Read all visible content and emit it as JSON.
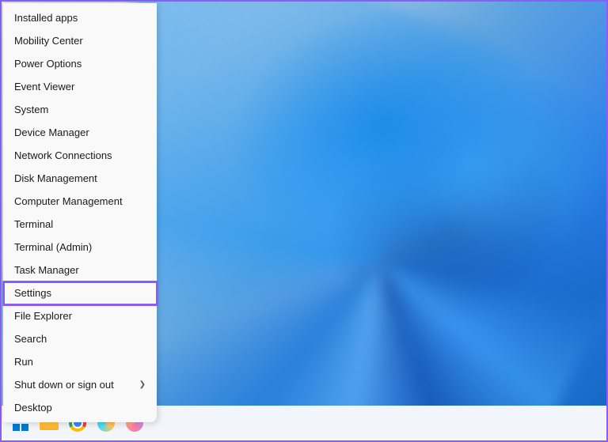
{
  "context_menu": {
    "items": [
      {
        "label": "Installed apps",
        "has_submenu": false
      },
      {
        "label": "Mobility Center",
        "has_submenu": false
      },
      {
        "label": "Power Options",
        "has_submenu": false
      },
      {
        "label": "Event Viewer",
        "has_submenu": false
      },
      {
        "label": "System",
        "has_submenu": false
      },
      {
        "label": "Device Manager",
        "has_submenu": false
      },
      {
        "label": "Network Connections",
        "has_submenu": false
      },
      {
        "label": "Disk Management",
        "has_submenu": false
      },
      {
        "label": "Computer Management",
        "has_submenu": false
      },
      {
        "label": "Terminal",
        "has_submenu": false
      },
      {
        "label": "Terminal (Admin)",
        "has_submenu": false
      },
      {
        "label": "Task Manager",
        "has_submenu": false
      },
      {
        "label": "Settings",
        "has_submenu": false,
        "highlighted": true
      },
      {
        "label": "File Explorer",
        "has_submenu": false
      },
      {
        "label": "Search",
        "has_submenu": false
      },
      {
        "label": "Run",
        "has_submenu": false
      },
      {
        "label": "Shut down or sign out",
        "has_submenu": true
      },
      {
        "label": "Desktop",
        "has_submenu": false
      }
    ]
  },
  "highlight": {
    "color": "#8b5cf6"
  },
  "taskbar": {
    "icons": [
      "start",
      "file-explorer",
      "chrome",
      "app-a",
      "app-b"
    ]
  }
}
